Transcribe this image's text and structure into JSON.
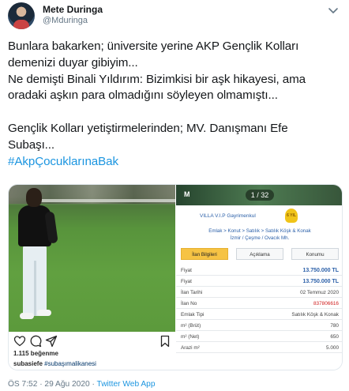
{
  "author": {
    "name": "Mete Duringa",
    "handle": "@Mduringa"
  },
  "tweet": {
    "lines": [
      "Bunlara bakarken; üniversite yerine AKP Gençlik Kolları",
      "demenizi duyar gibiyim...",
      "Ne demişti Binali Yıldırım: Bizimkisi bir aşk hikayesi, ama",
      "oradaki aşkın para olmadığını söyleyen olmamıştı...",
      "",
      "Gençlik Kolları yetiştirmelerinden; MV. Danışmanı Efe",
      "Subaşı..."
    ],
    "hashtag": "#AkpÇocuklarınaBak"
  },
  "instagram": {
    "likes": "1.115 beğenme",
    "caption_user": "subasiefe",
    "caption_tag": "#subaşımalikanesi"
  },
  "listing": {
    "counter": "1 / 32",
    "logo": "M",
    "agency": "VILLA V.I.P Gayrimenkul",
    "badge": "6 YIL",
    "breadcrumb_line1": "Emlak > Konut > Satılık > Satılık Köşk & Konak",
    "breadcrumb_line2": "İzmir / Çeşme / Ovacık Mh.",
    "tabs": [
      "İlan Bilgileri",
      "Açıklama",
      "Konumu"
    ],
    "rows": [
      {
        "label": "Fiyat",
        "value": "13.750.000 TL"
      },
      {
        "label": "Fiyat",
        "value": "13.750.000 TL"
      },
      {
        "label": "İlan Tarihi",
        "value": "02 Temmuz 2020"
      },
      {
        "label": "İlan No",
        "value": "837806616"
      },
      {
        "label": "Emlak Tipi",
        "value": "Satılık Köşk & Konak"
      },
      {
        "label": "m² (Brüt)",
        "value": "780"
      },
      {
        "label": "m² (Net)",
        "value": "650"
      },
      {
        "label": "Arazi m²",
        "value": "5.000"
      }
    ]
  },
  "footer": {
    "timestamp": "ÖS 7:52 · 29 Ağu 2020 · ",
    "source": "Twitter Web App"
  },
  "colors": {
    "link": "#1b95e0",
    "muted": "#657786"
  }
}
